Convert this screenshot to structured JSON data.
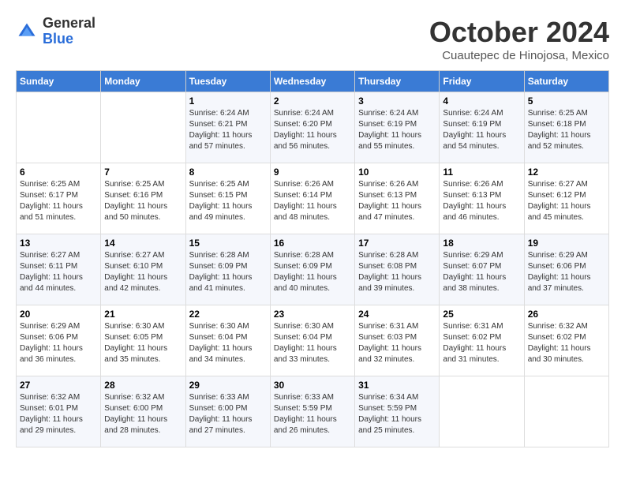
{
  "header": {
    "logo": {
      "general": "General",
      "blue": "Blue"
    },
    "title": "October 2024",
    "location": "Cuautepec de Hinojosa, Mexico"
  },
  "weekdays": [
    "Sunday",
    "Monday",
    "Tuesday",
    "Wednesday",
    "Thursday",
    "Friday",
    "Saturday"
  ],
  "weeks": [
    [
      {
        "day": null,
        "info": null
      },
      {
        "day": null,
        "info": null
      },
      {
        "day": "1",
        "info": "Sunrise: 6:24 AM\nSunset: 6:21 PM\nDaylight: 11 hours and 57 minutes."
      },
      {
        "day": "2",
        "info": "Sunrise: 6:24 AM\nSunset: 6:20 PM\nDaylight: 11 hours and 56 minutes."
      },
      {
        "day": "3",
        "info": "Sunrise: 6:24 AM\nSunset: 6:19 PM\nDaylight: 11 hours and 55 minutes."
      },
      {
        "day": "4",
        "info": "Sunrise: 6:24 AM\nSunset: 6:19 PM\nDaylight: 11 hours and 54 minutes."
      },
      {
        "day": "5",
        "info": "Sunrise: 6:25 AM\nSunset: 6:18 PM\nDaylight: 11 hours and 52 minutes."
      }
    ],
    [
      {
        "day": "6",
        "info": "Sunrise: 6:25 AM\nSunset: 6:17 PM\nDaylight: 11 hours and 51 minutes."
      },
      {
        "day": "7",
        "info": "Sunrise: 6:25 AM\nSunset: 6:16 PM\nDaylight: 11 hours and 50 minutes."
      },
      {
        "day": "8",
        "info": "Sunrise: 6:25 AM\nSunset: 6:15 PM\nDaylight: 11 hours and 49 minutes."
      },
      {
        "day": "9",
        "info": "Sunrise: 6:26 AM\nSunset: 6:14 PM\nDaylight: 11 hours and 48 minutes."
      },
      {
        "day": "10",
        "info": "Sunrise: 6:26 AM\nSunset: 6:13 PM\nDaylight: 11 hours and 47 minutes."
      },
      {
        "day": "11",
        "info": "Sunrise: 6:26 AM\nSunset: 6:13 PM\nDaylight: 11 hours and 46 minutes."
      },
      {
        "day": "12",
        "info": "Sunrise: 6:27 AM\nSunset: 6:12 PM\nDaylight: 11 hours and 45 minutes."
      }
    ],
    [
      {
        "day": "13",
        "info": "Sunrise: 6:27 AM\nSunset: 6:11 PM\nDaylight: 11 hours and 44 minutes."
      },
      {
        "day": "14",
        "info": "Sunrise: 6:27 AM\nSunset: 6:10 PM\nDaylight: 11 hours and 42 minutes."
      },
      {
        "day": "15",
        "info": "Sunrise: 6:28 AM\nSunset: 6:09 PM\nDaylight: 11 hours and 41 minutes."
      },
      {
        "day": "16",
        "info": "Sunrise: 6:28 AM\nSunset: 6:09 PM\nDaylight: 11 hours and 40 minutes."
      },
      {
        "day": "17",
        "info": "Sunrise: 6:28 AM\nSunset: 6:08 PM\nDaylight: 11 hours and 39 minutes."
      },
      {
        "day": "18",
        "info": "Sunrise: 6:29 AM\nSunset: 6:07 PM\nDaylight: 11 hours and 38 minutes."
      },
      {
        "day": "19",
        "info": "Sunrise: 6:29 AM\nSunset: 6:06 PM\nDaylight: 11 hours and 37 minutes."
      }
    ],
    [
      {
        "day": "20",
        "info": "Sunrise: 6:29 AM\nSunset: 6:06 PM\nDaylight: 11 hours and 36 minutes."
      },
      {
        "day": "21",
        "info": "Sunrise: 6:30 AM\nSunset: 6:05 PM\nDaylight: 11 hours and 35 minutes."
      },
      {
        "day": "22",
        "info": "Sunrise: 6:30 AM\nSunset: 6:04 PM\nDaylight: 11 hours and 34 minutes."
      },
      {
        "day": "23",
        "info": "Sunrise: 6:30 AM\nSunset: 6:04 PM\nDaylight: 11 hours and 33 minutes."
      },
      {
        "day": "24",
        "info": "Sunrise: 6:31 AM\nSunset: 6:03 PM\nDaylight: 11 hours and 32 minutes."
      },
      {
        "day": "25",
        "info": "Sunrise: 6:31 AM\nSunset: 6:02 PM\nDaylight: 11 hours and 31 minutes."
      },
      {
        "day": "26",
        "info": "Sunrise: 6:32 AM\nSunset: 6:02 PM\nDaylight: 11 hours and 30 minutes."
      }
    ],
    [
      {
        "day": "27",
        "info": "Sunrise: 6:32 AM\nSunset: 6:01 PM\nDaylight: 11 hours and 29 minutes."
      },
      {
        "day": "28",
        "info": "Sunrise: 6:32 AM\nSunset: 6:00 PM\nDaylight: 11 hours and 28 minutes."
      },
      {
        "day": "29",
        "info": "Sunrise: 6:33 AM\nSunset: 6:00 PM\nDaylight: 11 hours and 27 minutes."
      },
      {
        "day": "30",
        "info": "Sunrise: 6:33 AM\nSunset: 5:59 PM\nDaylight: 11 hours and 26 minutes."
      },
      {
        "day": "31",
        "info": "Sunrise: 6:34 AM\nSunset: 5:59 PM\nDaylight: 11 hours and 25 minutes."
      },
      {
        "day": null,
        "info": null
      },
      {
        "day": null,
        "info": null
      }
    ]
  ]
}
